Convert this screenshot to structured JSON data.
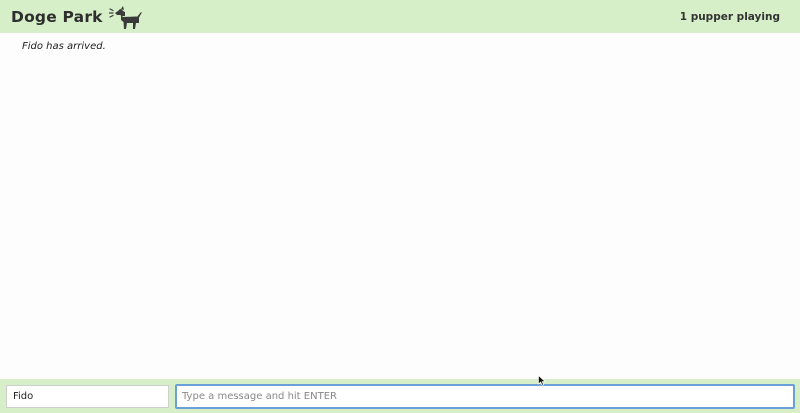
{
  "header": {
    "title": "Doge Park",
    "icon": "dog-icon",
    "player_count": "1 pupper playing"
  },
  "chat": {
    "messages": [
      {
        "text": "Fido has arrived."
      }
    ]
  },
  "footer": {
    "name_value": "Fido",
    "message_placeholder": "Type a message and hit ENTER",
    "message_value": ""
  },
  "colors": {
    "header_bg": "#d6efc8",
    "footer_bg": "#d6efc8",
    "input_focus_border": "#6a9fd8"
  }
}
